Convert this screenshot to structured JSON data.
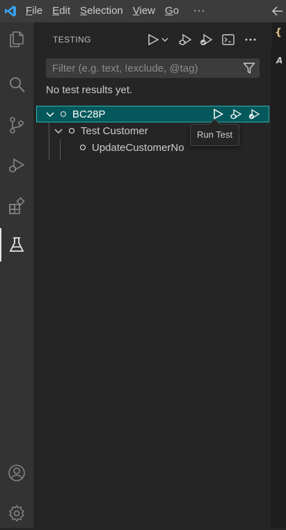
{
  "titlebar": {
    "menus": [
      {
        "label": "File",
        "mnemonic": "F",
        "rest": "ile"
      },
      {
        "label": "Edit",
        "mnemonic": "E",
        "rest": "dit"
      },
      {
        "label": "Selection",
        "mnemonic": "S",
        "rest": "election"
      },
      {
        "label": "View",
        "mnemonic": "V",
        "rest": "iew"
      },
      {
        "label": "Go",
        "mnemonic": "G",
        "rest": "o"
      }
    ],
    "more": "···",
    "accent": "#3b9ee8"
  },
  "activitybar": {
    "items": [
      "explorer-icon",
      "search-icon",
      "source-control-icon",
      "run-debug-icon",
      "extensions-icon",
      "testing-icon"
    ],
    "active": "testing-icon",
    "bottom": [
      "accounts-icon",
      "manage-gear-icon"
    ]
  },
  "sidebar": {
    "title": "TESTING",
    "filter_placeholder": "Filter (e.g. text, !exclude, @tag)",
    "filter_value": "",
    "status": "No test results yet.",
    "tree": {
      "root": {
        "label": "BC28P",
        "selected": true
      },
      "children": [
        {
          "label": "Test Customer",
          "children": [
            {
              "label": "UpdateCustomerNo"
            }
          ]
        }
      ]
    },
    "tooltip": "Run Test",
    "selection_color": "#04585b"
  },
  "editor": {
    "tab_glyph": "{",
    "crumb": "A"
  }
}
